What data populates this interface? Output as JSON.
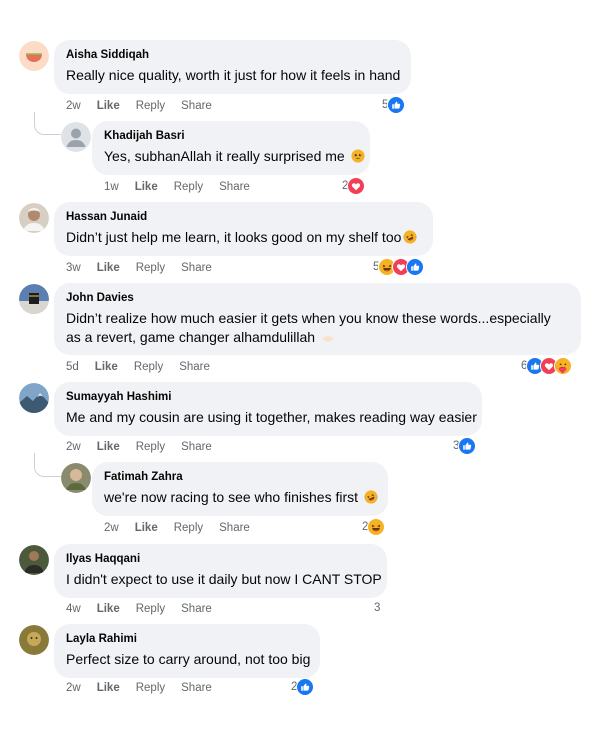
{
  "comments": [
    {
      "author": "Aisha Siddiqah",
      "text": "Really nice quality, worth it just for how it feels in hand",
      "time": "2w",
      "like": "Like",
      "reply": "Reply",
      "share": "Share",
      "count": "5",
      "reactions": [
        "like-icon"
      ]
    },
    {
      "author": "Khadijah Basri",
      "text": "Yes, subhanAllah it really surprised me",
      "emoji": "face-holding-back-tears-icon",
      "time": "1w",
      "like": "Like",
      "reply": "Reply",
      "share": "Share",
      "count": "2",
      "reactions": [
        "love-icon"
      ]
    },
    {
      "author": "Hassan Junaid",
      "text": "Didn’t just help me learn, it looks good on my shelf too",
      "emoji": "rolling-laughing-icon",
      "time": "3w",
      "like": "Like",
      "reply": "Reply",
      "share": "Share",
      "count": "5",
      "reactions": [
        "haha-icon",
        "love-icon",
        "like-icon"
      ]
    },
    {
      "author": "John Davies",
      "text": "Didn’t realize how much easier it gets when you know these words...especially as a revert, game changer alhamdulillah",
      "emoji": "palms-up-together-icon",
      "time": "5d",
      "like": "Like",
      "reply": "Reply",
      "share": "Share",
      "count": "6",
      "reactions": [
        "like-icon",
        "love-icon",
        "care-icon"
      ]
    },
    {
      "author": "Sumayyah Hashimi",
      "text": "Me and my cousin are using it together, makes reading way easier",
      "time": "2w",
      "like": "Like",
      "reply": "Reply",
      "share": "Share",
      "count": "3",
      "reactions": [
        "like-icon"
      ]
    },
    {
      "author": "Fatimah Zahra",
      "text": "we're now racing to see who finishes first",
      "emoji": "rolling-laughing-icon",
      "time": "2w",
      "like": "Like",
      "reply": "Reply",
      "share": "Share",
      "count": "2",
      "reactions": [
        "haha-icon"
      ]
    },
    {
      "author": "Ilyas Haqqani",
      "text": "I didn't expect to use it daily but now I CANT STOP",
      "time": "4w",
      "like": "Like",
      "reply": "Reply",
      "share": "Share",
      "count": "3",
      "reactions": []
    },
    {
      "author": "Layla Rahimi",
      "text": "Perfect size to carry around, not too big",
      "time": "2w",
      "like": "Like",
      "reply": "Reply",
      "share": "Share",
      "count": "2",
      "reactions": [
        "like-icon"
      ]
    }
  ],
  "colors": {
    "like": "#1877f2",
    "love": "#f33e58",
    "haha": "#f7b125",
    "bubble": "#f0f2f5",
    "meta": "#65676b"
  }
}
